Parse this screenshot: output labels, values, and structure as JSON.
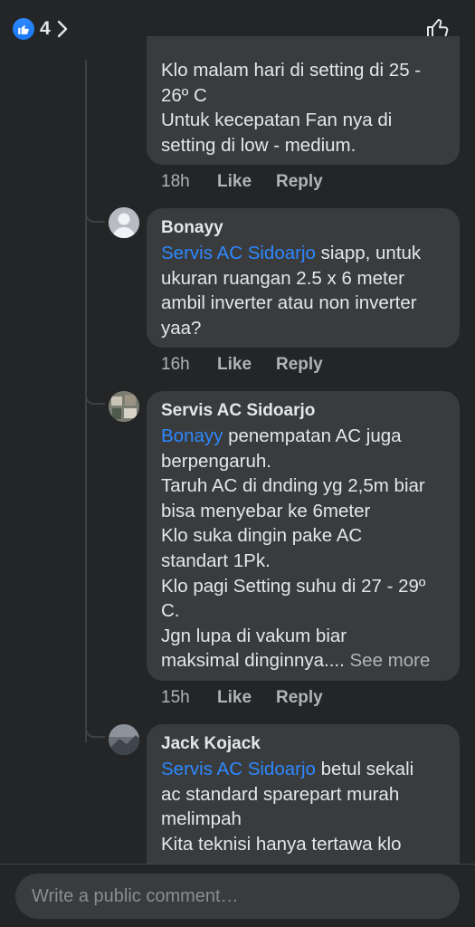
{
  "header": {
    "reaction_count": "4"
  },
  "comments": [
    {
      "text": "Klo malam hari di setting di 25 -\n26º C\nUntuk kecepatan Fan nya di\nsetting di low - medium.",
      "time": "18h",
      "like": "Like",
      "reply": "Reply"
    },
    {
      "author": "Bonayy",
      "mention": "Servis AC Sidoarjo",
      "text": " siapp, untuk\nukuran ruangan 2.5 x 6 meter\nambil inverter atau non inverter\nyaa?",
      "time": "16h",
      "like": "Like",
      "reply": "Reply"
    },
    {
      "author": "Servis AC Sidoarjo",
      "mention": "Bonayy",
      "text": " penempatan AC juga\nberpengaruh.\nTaruh AC di dnding yg 2,5m biar\nbisa menyebar ke 6meter\nKlo suka dingin pake AC\nstandart 1Pk.\nKlo pagi Setting suhu di 27 - 29º\nC.\nJgn lupa di vakum biar\nmaksimal dinginnya....",
      "see_more": " See more",
      "time": "15h",
      "like": "Like",
      "reply": "Reply"
    },
    {
      "author": "Jack Kojack",
      "mention": "Servis AC Sidoarjo",
      "text": " betul sekali\nac standard sparepart murah\nmelimpah\nKita teknisi hanya tertawa klo"
    }
  ],
  "composer": {
    "placeholder": "Write a public comment…"
  },
  "colors": {
    "background": "#242526",
    "bubble": "#3a3b3c",
    "mention": "#2d88ff",
    "meta": "#b0b3b8"
  }
}
